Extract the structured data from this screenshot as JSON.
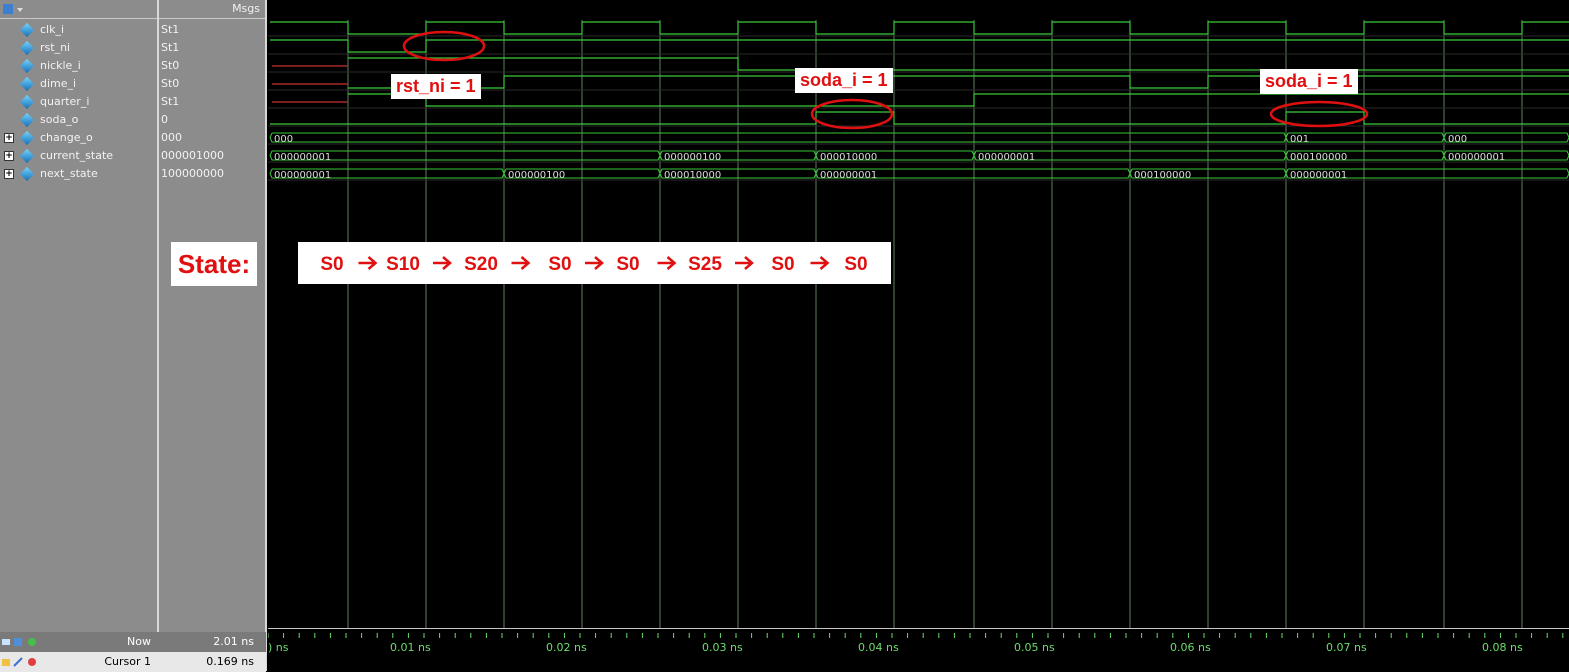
{
  "header": {
    "msgs_label": "Msgs"
  },
  "signals": [
    {
      "name": "clk_i",
      "value": "St1",
      "expandable": false
    },
    {
      "name": "rst_ni",
      "value": "St1",
      "expandable": false
    },
    {
      "name": "nickle_i",
      "value": "St0",
      "expandable": false
    },
    {
      "name": "dime_i",
      "value": "St0",
      "expandable": false
    },
    {
      "name": "quarter_i",
      "value": "St1",
      "expandable": false
    },
    {
      "name": "soda_o",
      "value": "0",
      "expandable": false
    },
    {
      "name": "change_o",
      "value": "000",
      "expandable": true
    },
    {
      "name": "current_state",
      "value": "000001000",
      "expandable": true
    },
    {
      "name": "next_state",
      "value": "100000000",
      "expandable": true
    }
  ],
  "bus_values": {
    "change_o": [
      "000",
      "001",
      "000"
    ],
    "current_state": [
      "000000001",
      "000000100",
      "000010000",
      "000000001",
      "000100000",
      "000000001"
    ],
    "next_state": [
      "000000001",
      "000000100",
      "000010000",
      "000000001",
      "000100000",
      "000000001"
    ]
  },
  "status": {
    "now_label": "Now",
    "now_value": "2.01 ns",
    "cursor_label": "Cursor 1",
    "cursor_value": "0.169 ns"
  },
  "timeline": {
    "ticks": [
      ") ns",
      "0.01 ns",
      "0.02 ns",
      "0.03 ns",
      "0.04 ns",
      "0.05 ns",
      "0.06 ns",
      "0.07 ns",
      "0.08 ns"
    ]
  },
  "annotations": {
    "rst": "rst_ni = 1",
    "soda1": "soda_i = 1",
    "soda2": "soda_i = 1",
    "state_label": "State:",
    "state_seq": [
      "S0",
      "S10",
      "S20",
      "S0",
      "S0",
      "S25",
      "S0",
      "S0"
    ]
  },
  "colors": {
    "wave": "#39c939",
    "annot": "#e01010",
    "panel": "#8c8c8c"
  }
}
